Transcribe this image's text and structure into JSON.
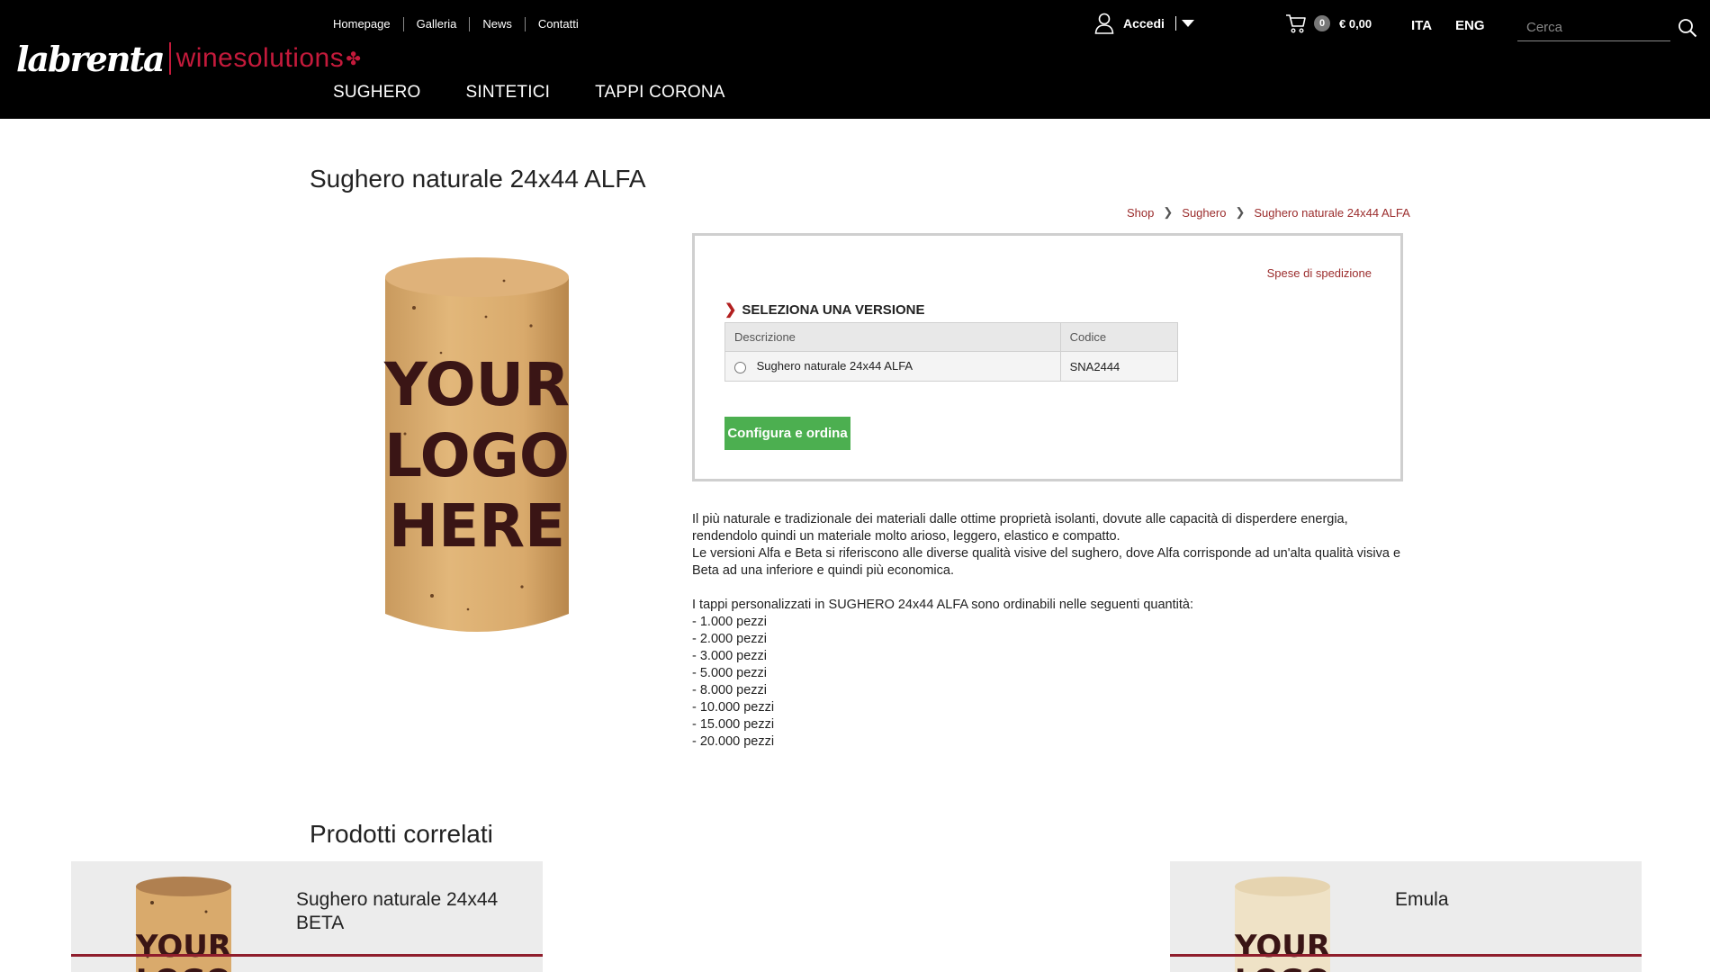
{
  "brand": {
    "primary": "labrenta",
    "secondary": "winesolutions",
    "accent_color": "#c41a3b"
  },
  "top_nav": [
    "Homepage",
    "Galleria",
    "News",
    "Contatti"
  ],
  "main_nav": [
    "SUGHERO",
    "SINTETICI",
    "TAPPI CORONA"
  ],
  "account": {
    "label": "Accedi",
    "icon": "user-icon"
  },
  "cart": {
    "count": "0",
    "total": "€ 0,00",
    "icon": "cart-icon"
  },
  "languages": {
    "ita": "ITA",
    "eng": "ENG"
  },
  "search": {
    "placeholder": "Cerca",
    "icon": "search-icon"
  },
  "product": {
    "title": "Sughero naturale 24x44 ALFA",
    "image_text": [
      "YOUR",
      "LOGO",
      "HERE"
    ]
  },
  "breadcrumb": [
    "Shop",
    "Sughero",
    "Sughero naturale 24x44 ALFA"
  ],
  "order_box": {
    "shipping_link": "Spese di spedizione",
    "version_title": "SELEZIONA UNA VERSIONE",
    "columns": [
      "Descrizione",
      "Codice"
    ],
    "rows": [
      {
        "descrizione": "Sughero naturale 24x44 ALFA",
        "codice": "SNA2444"
      }
    ],
    "order_button": "Configura e ordina",
    "button_color": "#4caf50"
  },
  "description": {
    "paragraph1": "Il più naturale e tradizionale dei materiali dalle ottime proprietà isolanti, dovute alle capacità di disperdere energia, rendendolo quindi un materiale molto arioso, leggero, elastico e compatto.",
    "paragraph2": "Le versioni Alfa e Beta si riferiscono alle diverse qualità visive del sughero, dove Alfa corrisponde ad un'alta qualità visiva e Beta ad una inferiore e quindi più economica.",
    "quantities_intro": "I tappi personalizzati in SUGHERO 24x44 ALFA sono ordinabili nelle seguenti quantità:",
    "quantities": [
      "- 1.000 pezzi",
      "- 2.000 pezzi",
      "- 3.000 pezzi",
      "- 5.000 pezzi",
      "- 8.000 pezzi",
      "- 10.000 pezzi",
      "- 15.000 pezzi",
      "- 20.000 pezzi"
    ]
  },
  "related": {
    "title": "Prodotti correlati",
    "items": [
      {
        "name": "Sughero naturale 24x44 BETA"
      },
      {
        "name": "Emula"
      }
    ]
  }
}
